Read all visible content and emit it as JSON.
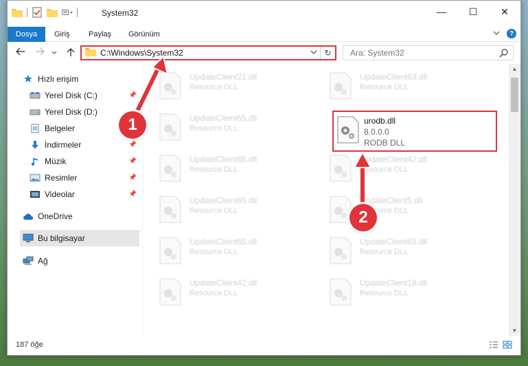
{
  "window": {
    "title": "System32",
    "controls": {
      "minimize": "—",
      "maximize": "☐",
      "close": "✕"
    }
  },
  "ribbon": {
    "tabs": [
      "Dosya",
      "Giriş",
      "Paylaş",
      "Görünüm"
    ]
  },
  "address": {
    "path": "C:\\Windows\\System32",
    "search_placeholder": "Ara: System32"
  },
  "nav_pane": {
    "items": [
      {
        "label": "Hızlı erişim",
        "icon": "star-icon",
        "pinned": false
      },
      {
        "label": "Yerel Disk (C:)",
        "icon": "drive-icon",
        "pinned": true
      },
      {
        "label": "Yerel Disk (D:)",
        "icon": "drive-icon",
        "pinned": false
      },
      {
        "label": "Belgeler",
        "icon": "documents-icon",
        "pinned": true
      },
      {
        "label": "İndirmeler",
        "icon": "download-icon",
        "pinned": true
      },
      {
        "label": "Müzik",
        "icon": "music-icon",
        "pinned": true
      },
      {
        "label": "Resimler",
        "icon": "pictures-icon",
        "pinned": true
      },
      {
        "label": "Videolar",
        "icon": "videos-icon",
        "pinned": true
      },
      {
        "label": "OneDrive",
        "icon": "cloud-icon",
        "pinned": false
      },
      {
        "label": "Bu bilgisayar",
        "icon": "computer-icon",
        "pinned": false,
        "selected": true
      },
      {
        "label": "Ağ",
        "icon": "network-icon",
        "pinned": false
      }
    ]
  },
  "files": [
    {
      "name": "UpdateClient21.dll",
      "desc": "Resource DLL"
    },
    {
      "name": "UpdateClient63.dll",
      "desc": "Resource DLL"
    },
    {
      "name": "UpdateClient65.dll",
      "desc": "Resource DLL"
    },
    {
      "name": "UpdateClient65.dll",
      "desc": "Resource DLL"
    },
    {
      "name": "UpdateClient42.dll",
      "desc": "Resource DLL"
    },
    {
      "name": "UpdateClient65.dll",
      "desc": "Resource DLL"
    },
    {
      "name": "UpdateClient5.dll",
      "desc": "Resource DLL"
    },
    {
      "name": "UpdateClient65.dll",
      "desc": "Resource DLL"
    },
    {
      "name": "UpdateClient65.dll",
      "desc": "Resource DLL"
    },
    {
      "name": "UpdateClient42.dll",
      "desc": "Resource DLL"
    },
    {
      "name": "UpdateClient19.dll",
      "desc": "Resource DLL"
    }
  ],
  "highlighted_file": {
    "name": "urodb.dll",
    "version": "8.0.0.0",
    "desc": "RODB DLL"
  },
  "status": {
    "count": "187 öğe"
  },
  "annotations": {
    "badge1": "1",
    "badge2": "2"
  },
  "colors": {
    "accent": "#1979ca",
    "annotation_red": "#e0333a"
  }
}
